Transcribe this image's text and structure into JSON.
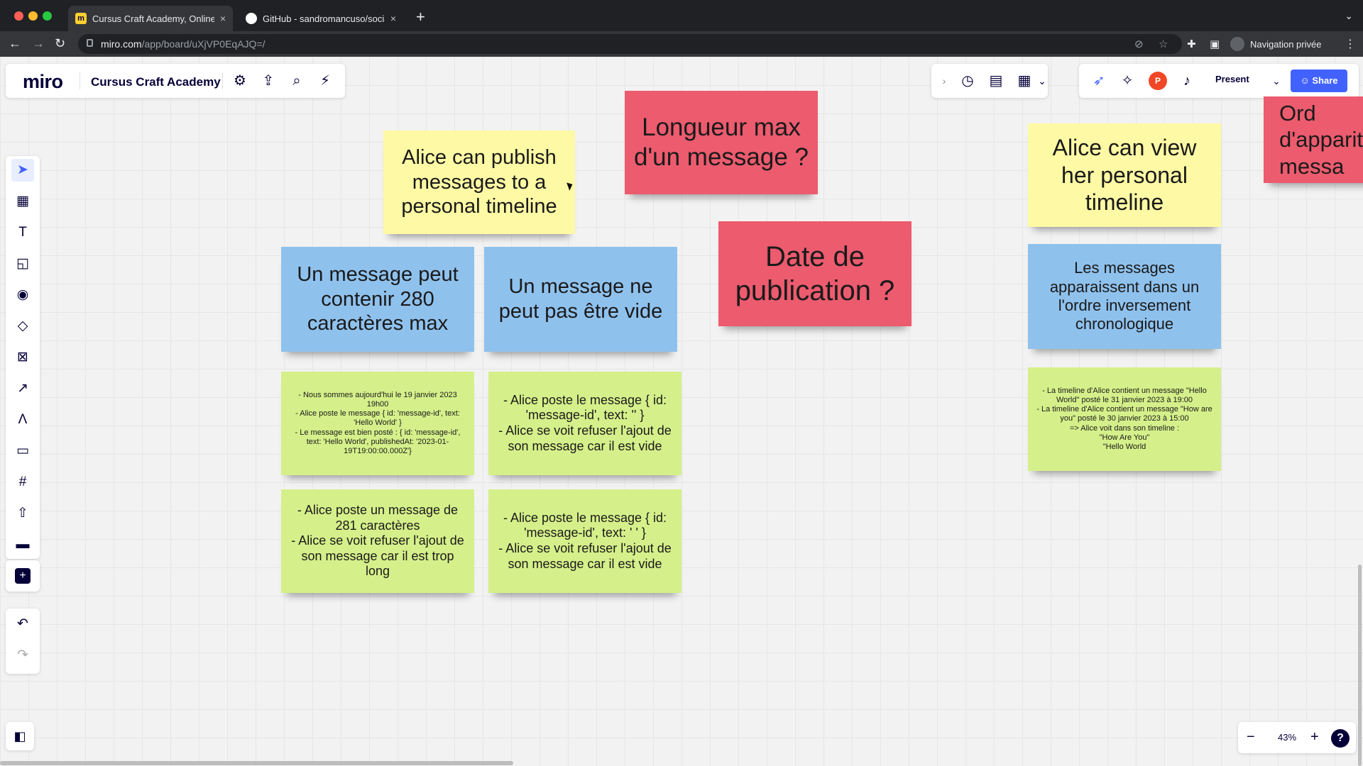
{
  "browser": {
    "tabs": [
      {
        "title": "Cursus Craft Academy, Online",
        "close": "×"
      },
      {
        "title": "GitHub - sandromancuso/socia",
        "close": "×"
      }
    ],
    "new_tab": "+",
    "url_host": "miro.com",
    "url_path": "/app/board/uXjVP0EqAJQ=/",
    "private_label": "Navigation privée"
  },
  "miro": {
    "logo": "miro",
    "board_name": "Cursus Craft Academy",
    "present_label": "Present",
    "share_label": "Share",
    "avatar_initial": "P",
    "zoom": "43%",
    "help": "?"
  },
  "stickies": {
    "alice_publish": "Alice can publish messages to a personal timeline",
    "longueur_max": "Longueur max d'un message ?",
    "alice_view": "Alice can view her personal timeline",
    "ordre_partial": "Ord\nd'apparit\nmessa",
    "msg_280": "Un message peut contenir 280 caractères max",
    "msg_not_empty": "Un message ne peut pas être vide",
    "date_publication": "Date de publication ?",
    "ordre_inverse": "Les messages apparaissent dans un l'ordre inversement chronologique",
    "ex_posted": "- Nous sommes aujourd'hui le 19 janvier 2023 19h00\n- Alice poste le message { id: 'message-id', text: 'Hello World' }\n- Le message est bien posté : { id: 'message-id', text: 'Hello World', publishedAt: '2023-01-19T19:00:00.000Z'}",
    "ex_empty": "- Alice poste le message { id: 'message-id', text: '' }\n- Alice se voit refuser l'ajout de son message car il est vide",
    "ex_timeline": "- La timeline d'Alice contient un message \"Hello World\" posté le 31 janvier 2023 à 19:00\n- La timeline d'Alice contient un message \"How are you\" posté le 30 janvier 2023 à 15:00\n=> Alice voit dans son timeline :\n\"How Are You\"\n\"Hello World",
    "ex_281": "- Alice poste un message de 281 caractères\n- Alice se voit refuser l'ajout de son message car il est trop long",
    "ex_spaces": "- Alice poste le message { id: 'message-id', text: '       ' }\n- Alice se voit refuser l'ajout de son message car il est vide"
  }
}
